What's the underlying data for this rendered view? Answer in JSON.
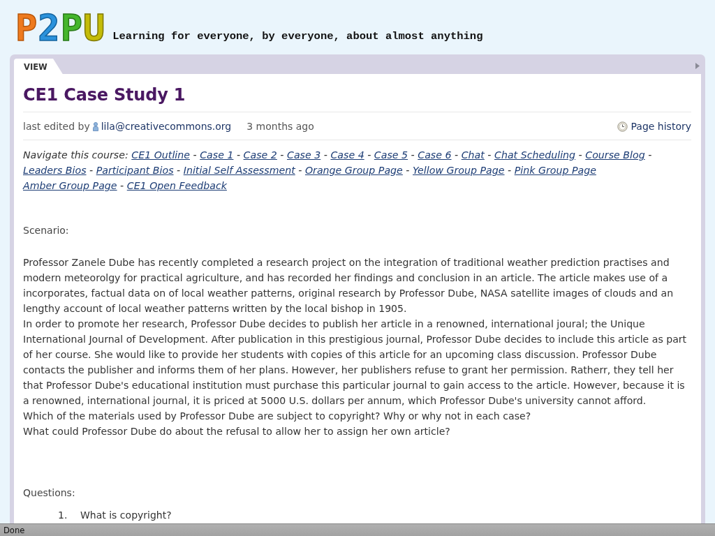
{
  "header": {
    "logo": "P2PU",
    "tagline": "Learning for everyone, by everyone, about almost anything"
  },
  "tabs": [
    {
      "label": "VIEW",
      "selected": true
    }
  ],
  "page": {
    "title": "CE1 Case Study 1",
    "meta": {
      "prefix": "last edited by",
      "user": "lila@creativecommons.org",
      "time": "3 months ago",
      "history_link": "Page history"
    }
  },
  "navigation": {
    "label": "Navigate this course:",
    "links": [
      {
        "label": "CE1 Outline",
        "separator": "-"
      },
      {
        "label": "Case 1",
        "separator": "-"
      },
      {
        "label": "Case 2",
        "separator": "-"
      },
      {
        "label": "Case 3",
        "separator": "-"
      },
      {
        "label": "Case 4",
        "separator": "-"
      },
      {
        "label": "Case 5",
        "separator": "-"
      },
      {
        "label": "Case 6",
        "separator": "-"
      },
      {
        "label": "Chat",
        "separator": "-"
      },
      {
        "label": "Chat Scheduling",
        "separator": "-"
      },
      {
        "label": "Course Blog",
        "separator": "-"
      },
      {
        "label": "Leaders Bios",
        "separator": "-"
      },
      {
        "label": "Participant Bios",
        "separator": "-"
      },
      {
        "label": "Initial Self Assessment",
        "separator": "-"
      },
      {
        "label": "Orange Group Page",
        "separator": "-"
      },
      {
        "label": "Yellow Group Page",
        "separator": "-"
      },
      {
        "label": "Pink Group Page"
      },
      {
        "label": "Amber Group Page",
        "separator": "-"
      },
      {
        "label": "CE1 Open Feedback"
      }
    ]
  },
  "scenario": {
    "heading": "Scenario:",
    "paragraphs": [
      "Professor Zanele Dube has recently completed a research project on the integration of traditional weather prediction practises and modern meteorolgy for practical agriculture, and has recorded her findings and conclusion in an article. The article makes use of a incorporates, factual data on of local weather patterns, original research by Professor Dube, NASA satellite images of clouds and an lengthy account of local weather patterns written by the local bishop in 1905.",
      "In order to promote her research, Professor Dube decides to publish her article in a renowned, international joural; the Unique International Journal of Development. After publication in this prestigious journal, Professor Dube decides to include this article as part of her course. She would like to provide her students with copies of this article for an upcoming class discussion. Professor Dube contacts the publisher and informs them of her plans. However, her publishers refuse to grant her permission. Ratherr, they tell her that Professor Dube's educational institution must purchase this particular journal to gain access to the article. However, because it is a renowned, international journal, it is priced at 5000 U.S. dollars per annum, which Professor Dube's university cannot afford.",
      "Which of the materials used by Professor Dube are subject to copyright? Why or why not in each case?",
      "What could Professor Dube do about the refusal to allow her to assign her own article?"
    ]
  },
  "questions": {
    "heading": "Questions:",
    "items": [
      {
        "number": "1.",
        "text": "What is copyright?"
      }
    ]
  },
  "status_bar": {
    "text": "Done"
  }
}
